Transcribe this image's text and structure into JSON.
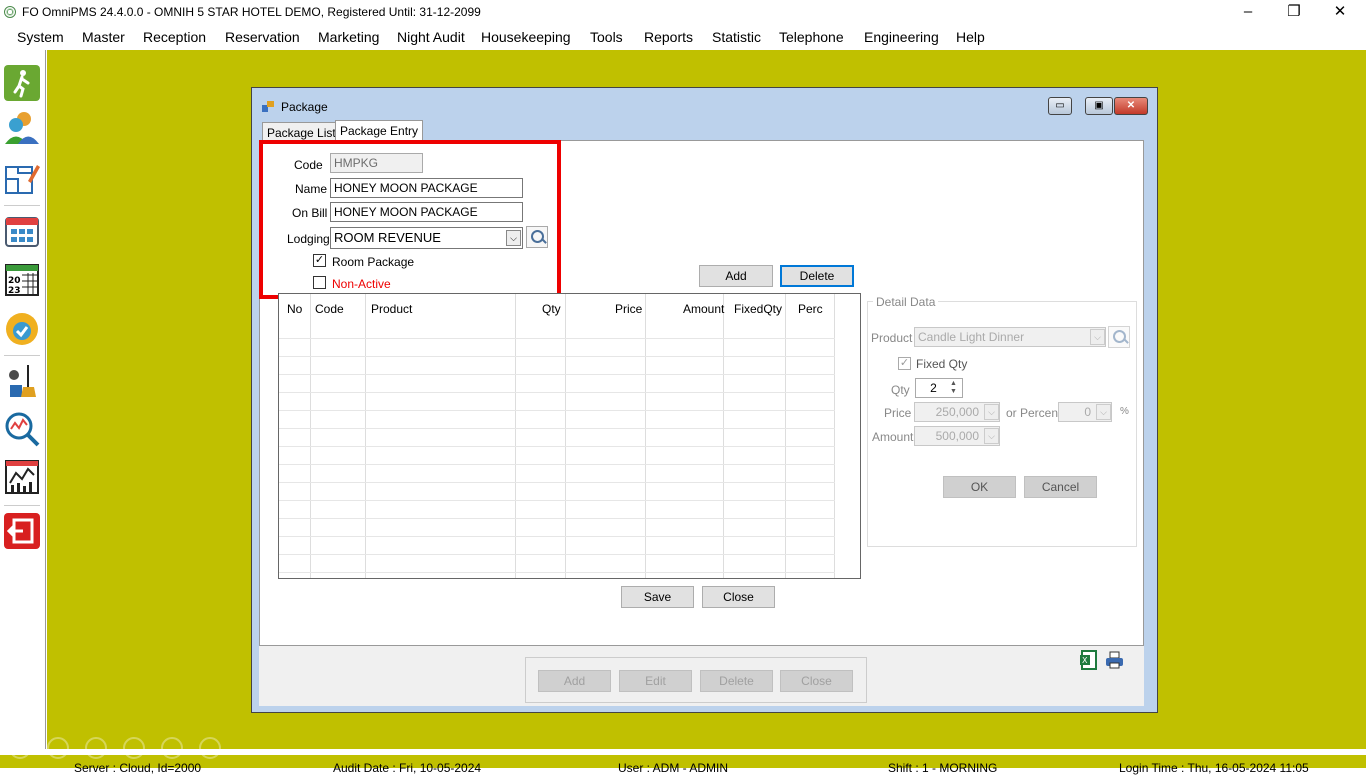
{
  "app": {
    "title": "FO OmniPMS 24.4.0.0 - OMNIH 5 STAR HOTEL DEMO, Registered Until: 31-12-2099"
  },
  "window_controls": {
    "minimize": "–",
    "restore": "❐",
    "close": "✕"
  },
  "menu": [
    "System",
    "Master",
    "Reception",
    "Reservation",
    "Marketing",
    "Night Audit",
    "Housekeeping",
    "Tools",
    "Reports",
    "Statistic",
    "Telephone",
    "Engineering",
    "Help"
  ],
  "dialog": {
    "title": "Package",
    "tabs": [
      "Package List",
      "Package Entry"
    ],
    "active_tab": "Package Entry",
    "form": {
      "code_label": "Code",
      "code_value": "HMPKG",
      "name_label": "Name",
      "name_value": "HONEY MOON PACKAGE",
      "onbill_label": "On Bill",
      "onbill_value": "HONEY MOON PACKAGE",
      "lodging_label": "Lodging",
      "lodging_value": "ROOM REVENUE",
      "room_package_label": "Room Package",
      "room_package_checked": true,
      "non_active_label": "Non-Active",
      "non_active_checked": false
    },
    "grid_buttons": {
      "add": "Add",
      "delete": "Delete"
    },
    "grid": {
      "columns": [
        "No",
        "Code",
        "Product",
        "Qty",
        "Price",
        "Amount",
        "FixedQty",
        "Perc"
      ],
      "rows": []
    },
    "detail": {
      "title": "Detail Data",
      "product_label": "Product",
      "product_value": "Candle Light Dinner",
      "fixed_qty_label": "Fixed Qty",
      "fixed_qty_checked": true,
      "qty_label": "Qty",
      "qty_value": "2",
      "price_label": "Price",
      "price_value": "250,000",
      "or_percent_label": "or Percent",
      "percent_value": "0",
      "percent_sign": "%",
      "amount_label": "Amount",
      "amount_value": "500,000",
      "ok": "OK",
      "cancel": "Cancel"
    },
    "save": "Save",
    "close": "Close",
    "bottom_buttons": {
      "add": "Add",
      "edit": "Edit",
      "delete": "Delete",
      "close": "Close"
    }
  },
  "statusbar": {
    "server": "Server : Cloud, Id=2000",
    "audit": "Audit Date : Fri, 10-05-2024",
    "user": "User : ADM - ADMIN",
    "shift": "Shift : 1 - MORNING",
    "login": "Login Time : Thu, 16-05-2024 11:05"
  },
  "colors": {
    "desktop": "#c0c000",
    "highlight": "#ee0000",
    "non_active_text": "#ee0000"
  }
}
